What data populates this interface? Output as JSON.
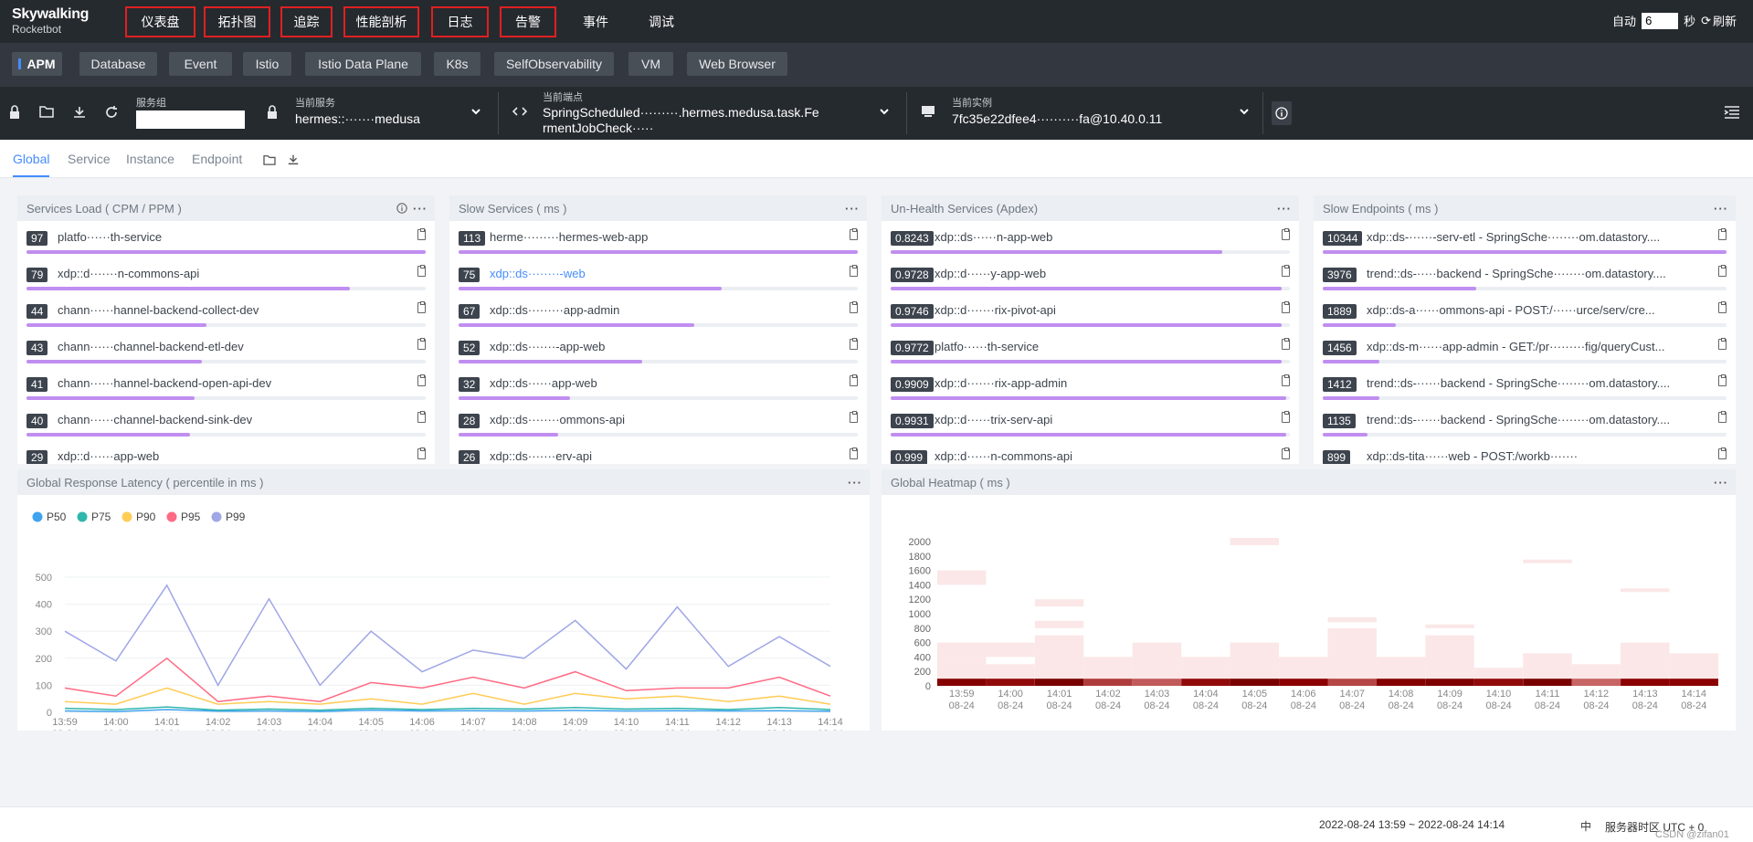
{
  "app": {
    "logo_line1": "Skywalking",
    "logo_line2": "Rocketbot"
  },
  "nav": [
    {
      "label": "仪表盘"
    },
    {
      "label": "拓扑图"
    },
    {
      "label": "追踪"
    },
    {
      "label": "性能剖析"
    },
    {
      "label": "日志"
    },
    {
      "label": "告警"
    },
    {
      "label": "事件"
    },
    {
      "label": "调试"
    }
  ],
  "auto": {
    "label": "自动",
    "value": "6",
    "unit": "秒",
    "refresh": "刷新"
  },
  "layers": [
    "APM",
    "Database",
    "Event",
    "Istio",
    "Istio Data Plane",
    "K8s",
    "SelfObservability",
    "VM",
    "Web Browser"
  ],
  "selectors": {
    "group_label": "服务组",
    "group_value": "",
    "service_label": "当前服务",
    "service_value": "hermes::·······medusa",
    "endpoint_label": "当前端点",
    "endpoint_value_1": "SpringScheduled·········.hermes.medusa.task.Fe",
    "endpoint_value_2": "rmentJobCheck·····",
    "instance_label": "当前实例",
    "instance_value": "7fc35e22dfee4··········fa@10.40.0.11"
  },
  "dash_tabs": [
    "Global",
    "Service",
    "Instance",
    "Endpoint"
  ],
  "panels": {
    "services_load": {
      "title": "Services Load ( CPM / PPM )",
      "rows": [
        {
          "value": "97",
          "name": "platfo······th-service",
          "pct": 1.0
        },
        {
          "value": "79",
          "name": "xdp::d·······n-commons-api",
          "pct": 0.81
        },
        {
          "value": "44",
          "name": "chann······hannel-backend-collect-dev",
          "pct": 0.45
        },
        {
          "value": "43",
          "name": "chann······channel-backend-etl-dev",
          "pct": 0.44
        },
        {
          "value": "41",
          "name": "chann······hannel-backend-open-api-dev",
          "pct": 0.42
        },
        {
          "value": "40",
          "name": "chann······channel-backend-sink-dev",
          "pct": 0.41
        },
        {
          "value": "29",
          "name": "xdp::d······app-web",
          "pct": 0.3
        }
      ]
    },
    "slow_services": {
      "title": "Slow Services ( ms )",
      "rows": [
        {
          "value": "113",
          "name": "herme·········hermes-web-app",
          "pct": 1.0,
          "link": false
        },
        {
          "value": "75",
          "name": "xdp::ds········-web",
          "pct": 0.66,
          "link": true
        },
        {
          "value": "67",
          "name": "xdp::ds·········app-admin",
          "pct": 0.59,
          "link": false
        },
        {
          "value": "52",
          "name": "xdp::ds·······-app-web",
          "pct": 0.46,
          "link": false
        },
        {
          "value": "32",
          "name": "xdp::ds······app-web",
          "pct": 0.28,
          "link": false
        },
        {
          "value": "28",
          "name": "xdp::ds········ommons-api",
          "pct": 0.25,
          "link": false
        },
        {
          "value": "26",
          "name": "xdp::ds·······erv-api",
          "pct": 0.23,
          "link": false
        }
      ]
    },
    "unhealth": {
      "title": "Un-Health Services (Apdex)",
      "rows": [
        {
          "value": "0.8243",
          "name": "xdp::ds······n-app-web",
          "pct": 0.83
        },
        {
          "value": "0.9728",
          "name": "xdp::d······y-app-web",
          "pct": 0.98
        },
        {
          "value": "0.9746",
          "name": "xdp::d·······rix-pivot-api",
          "pct": 0.98
        },
        {
          "value": "0.9772",
          "name": "platfo······th-service",
          "pct": 0.98
        },
        {
          "value": "0.9909",
          "name": "xdp::d·······rix-app-admin",
          "pct": 0.99
        },
        {
          "value": "0.9931",
          "name": "xdp::d······trix-serv-api",
          "pct": 0.99
        },
        {
          "value": "0.999",
          "name": "xdp::d······n-commons-api",
          "pct": 1.0
        }
      ]
    },
    "slow_endpoints": {
      "title": "Slow Endpoints ( ms )",
      "rows": [
        {
          "value": "10344",
          "name": "xdp::ds-······-serv-etl - SpringSche········om.datastory....",
          "pct": 1.0
        },
        {
          "value": "3976",
          "name": "trend::ds-·····backend - SpringSche········om.datastory....",
          "pct": 0.38
        },
        {
          "value": "1889",
          "name": "xdp::ds-a······ommons-api - POST:/······urce/serv/cre...",
          "pct": 0.18
        },
        {
          "value": "1456",
          "name": "xdp::ds-m······app-admin - GET:/pr·········fig/queryCust...",
          "pct": 0.14
        },
        {
          "value": "1412",
          "name": "trend::ds-······backend - SpringSche········om.datastory....",
          "pct": 0.14
        },
        {
          "value": "1135",
          "name": "trend::ds-······backend - SpringSche········om.datastory....",
          "pct": 0.11
        },
        {
          "value": "899",
          "name": "xdp::ds-tita······web - POST:/workb·······",
          "pct": 0.09
        }
      ]
    },
    "latency": {
      "title": "Global Response Latency ( percentile in ms )"
    },
    "heatmap": {
      "title": "Global Heatmap ( ms )"
    }
  },
  "chart_data": [
    {
      "type": "line",
      "title": "Global Response Latency ( percentile in ms )",
      "x": [
        "13:59\n08-24",
        "14:00\n08-24",
        "14:01\n08-24",
        "14:02\n08-24",
        "14:03\n08-24",
        "14:04\n08-24",
        "14:05\n08-24",
        "14:06\n08-24",
        "14:07\n08-24",
        "14:08\n08-24",
        "14:09\n08-24",
        "14:10\n08-24",
        "14:11\n08-24",
        "14:12\n08-24",
        "14:13\n08-24",
        "14:14\n08-24"
      ],
      "ylim": [
        0,
        500
      ],
      "yticks": [
        0,
        100,
        200,
        300,
        400,
        500
      ],
      "legend": "top-left",
      "series": [
        {
          "name": "P50",
          "color": "#3fa3ee",
          "values": [
            5,
            3,
            10,
            4,
            5,
            3,
            8,
            5,
            6,
            5,
            7,
            5,
            6,
            5,
            6,
            4
          ]
        },
        {
          "name": "P75",
          "color": "#30b7ac",
          "values": [
            15,
            10,
            20,
            8,
            12,
            8,
            15,
            10,
            15,
            12,
            18,
            12,
            15,
            10,
            18,
            10
          ]
        },
        {
          "name": "P90",
          "color": "#ffcc55",
          "values": [
            40,
            30,
            90,
            30,
            40,
            30,
            50,
            30,
            70,
            30,
            70,
            50,
            60,
            40,
            60,
            30
          ]
        },
        {
          "name": "P95",
          "color": "#ff6a84",
          "values": [
            90,
            60,
            200,
            40,
            60,
            40,
            110,
            90,
            130,
            90,
            150,
            80,
            90,
            90,
            130,
            60
          ]
        },
        {
          "name": "P99",
          "color": "#a0a7e6",
          "values": [
            300,
            190,
            470,
            100,
            420,
            100,
            300,
            150,
            230,
            200,
            340,
            160,
            390,
            170,
            280,
            170
          ]
        }
      ]
    },
    {
      "type": "heatmap",
      "title": "Global Heatmap ( ms )",
      "x": [
        "13:59\n08-24",
        "14:00\n08-24",
        "14:01\n08-24",
        "14:02\n08-24",
        "14:03\n08-24",
        "14:04\n08-24",
        "14:05\n08-24",
        "14:06\n08-24",
        "14:07\n08-24",
        "14:08\n08-24",
        "14:09\n08-24",
        "14:10\n08-24",
        "14:11\n08-24",
        "14:12\n08-24",
        "14:13\n08-24",
        "14:14\n08-24"
      ],
      "yticks": [
        0,
        200,
        400,
        600,
        800,
        1000,
        1200,
        1400,
        1600,
        1800,
        2000
      ],
      "cells": [
        {
          "col": 0,
          "from": 0,
          "to": 100,
          "level": 0.85
        },
        {
          "col": 1,
          "from": 0,
          "to": 100,
          "level": 0.75
        },
        {
          "col": 2,
          "from": 0,
          "to": 100,
          "level": 0.95
        },
        {
          "col": 3,
          "from": 0,
          "to": 100,
          "level": 0.5
        },
        {
          "col": 4,
          "from": 0,
          "to": 100,
          "level": 0.35
        },
        {
          "col": 5,
          "from": 0,
          "to": 100,
          "level": 0.75
        },
        {
          "col": 6,
          "from": 0,
          "to": 100,
          "level": 0.95
        },
        {
          "col": 7,
          "from": 0,
          "to": 100,
          "level": 0.8
        },
        {
          "col": 8,
          "from": 0,
          "to": 100,
          "level": 0.45
        },
        {
          "col": 9,
          "from": 0,
          "to": 100,
          "level": 0.85
        },
        {
          "col": 10,
          "from": 0,
          "to": 100,
          "level": 0.9
        },
        {
          "col": 11,
          "from": 0,
          "to": 100,
          "level": 0.75
        },
        {
          "col": 12,
          "from": 0,
          "to": 100,
          "level": 0.95
        },
        {
          "col": 13,
          "from": 0,
          "to": 100,
          "level": 0.3
        },
        {
          "col": 14,
          "from": 0,
          "to": 100,
          "level": 0.8
        },
        {
          "col": 15,
          "from": 0,
          "to": 100,
          "level": 0.8
        },
        {
          "col": 0,
          "from": 100,
          "to": 400,
          "level": 0.06
        },
        {
          "col": 0,
          "from": 400,
          "to": 600,
          "level": 0.06
        },
        {
          "col": 0,
          "from": 1400,
          "to": 1600,
          "level": 0.06
        },
        {
          "col": 1,
          "from": 100,
          "to": 300,
          "level": 0.06
        },
        {
          "col": 1,
          "from": 400,
          "to": 600,
          "level": 0.06
        },
        {
          "col": 2,
          "from": 100,
          "to": 700,
          "level": 0.06
        },
        {
          "col": 2,
          "from": 800,
          "to": 900,
          "level": 0.06
        },
        {
          "col": 2,
          "from": 1100,
          "to": 1200,
          "level": 0.06
        },
        {
          "col": 3,
          "from": 100,
          "to": 400,
          "level": 0.06
        },
        {
          "col": 4,
          "from": 100,
          "to": 600,
          "level": 0.06
        },
        {
          "col": 5,
          "from": 100,
          "to": 400,
          "level": 0.06
        },
        {
          "col": 6,
          "from": 100,
          "to": 600,
          "level": 0.06
        },
        {
          "col": 6,
          "from": 1950,
          "to": 2050,
          "level": 0.06
        },
        {
          "col": 7,
          "from": 100,
          "to": 400,
          "level": 0.06
        },
        {
          "col": 8,
          "from": 100,
          "to": 800,
          "level": 0.06
        },
        {
          "col": 8,
          "from": 880,
          "to": 950,
          "level": 0.06
        },
        {
          "col": 9,
          "from": 100,
          "to": 400,
          "level": 0.06
        },
        {
          "col": 10,
          "from": 100,
          "to": 700,
          "level": 0.06
        },
        {
          "col": 10,
          "from": 800,
          "to": 850,
          "level": 0.06
        },
        {
          "col": 11,
          "from": 100,
          "to": 250,
          "level": 0.06
        },
        {
          "col": 12,
          "from": 100,
          "to": 450,
          "level": 0.06
        },
        {
          "col": 12,
          "from": 1700,
          "to": 1750,
          "level": 0.06
        },
        {
          "col": 13,
          "from": 100,
          "to": 300,
          "level": 0.06
        },
        {
          "col": 14,
          "from": 100,
          "to": 600,
          "level": 0.06
        },
        {
          "col": 14,
          "from": 1300,
          "to": 1350,
          "level": 0.06
        },
        {
          "col": 15,
          "from": 100,
          "to": 450,
          "level": 0.06
        }
      ]
    }
  ],
  "footer": {
    "range": "2022-08-24 13:59 ~ 2022-08-24 14:14",
    "lang": "中",
    "tz": "服务器时区 UTC + 0",
    "watermark": "CSDN @zifan01"
  }
}
